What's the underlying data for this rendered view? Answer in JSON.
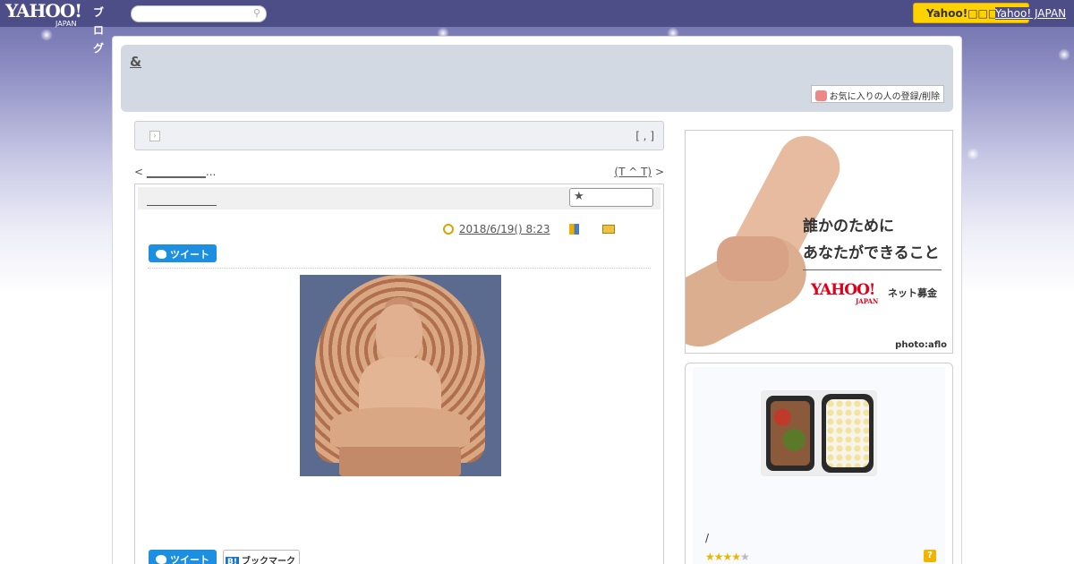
{
  "topbar": {
    "logo": "YAHOO!",
    "logo_sub": "JAPAN",
    "logo_blog": "ブログ",
    "search_placeholder": "",
    "yahoo_button": "Yahoo!□□□",
    "yahoo_link": "Yahoo! JAPAN",
    "search_icon": "magnifier-icon"
  },
  "header": {
    "blog_title": "&",
    "favorite_button": "お気に入りの人の登録/削除",
    "favorite_icon": "heart-icon"
  },
  "crumb": {
    "meta": "[ , ]",
    "arrow_icon": "arrow-icon"
  },
  "nav": {
    "prev_marker": "<",
    "prev_text": "___________",
    "prev_suffix": "...",
    "next_text": "(T ^ T)",
    "next_marker": ">"
  },
  "article": {
    "title": "",
    "date": "2018/6/19()  8:23",
    "category": "",
    "star_icon": "star-icon",
    "tweet_label": "ツイート",
    "bookmark_label": "ブックマーク",
    "bookmark_b": "B!"
  },
  "ad": {
    "line1": "誰かのために",
    "line2": "あなたができること",
    "yahoo": "YAHOO!",
    "yahoo_sub": "JAPAN",
    "net": "ネット募金",
    "credit": "photo:aflo"
  },
  "sidebar": {
    "caption": "/",
    "rating": 4,
    "rating_max": 5,
    "stars_on": "★★★★",
    "stars_off": "★",
    "help_icon": "?"
  },
  "colors": {
    "topbar": "#4d4d88",
    "yahoo_button": "#ffd200",
    "header_bg": "#d3d9e3",
    "tweet": "#1d8fe0"
  }
}
